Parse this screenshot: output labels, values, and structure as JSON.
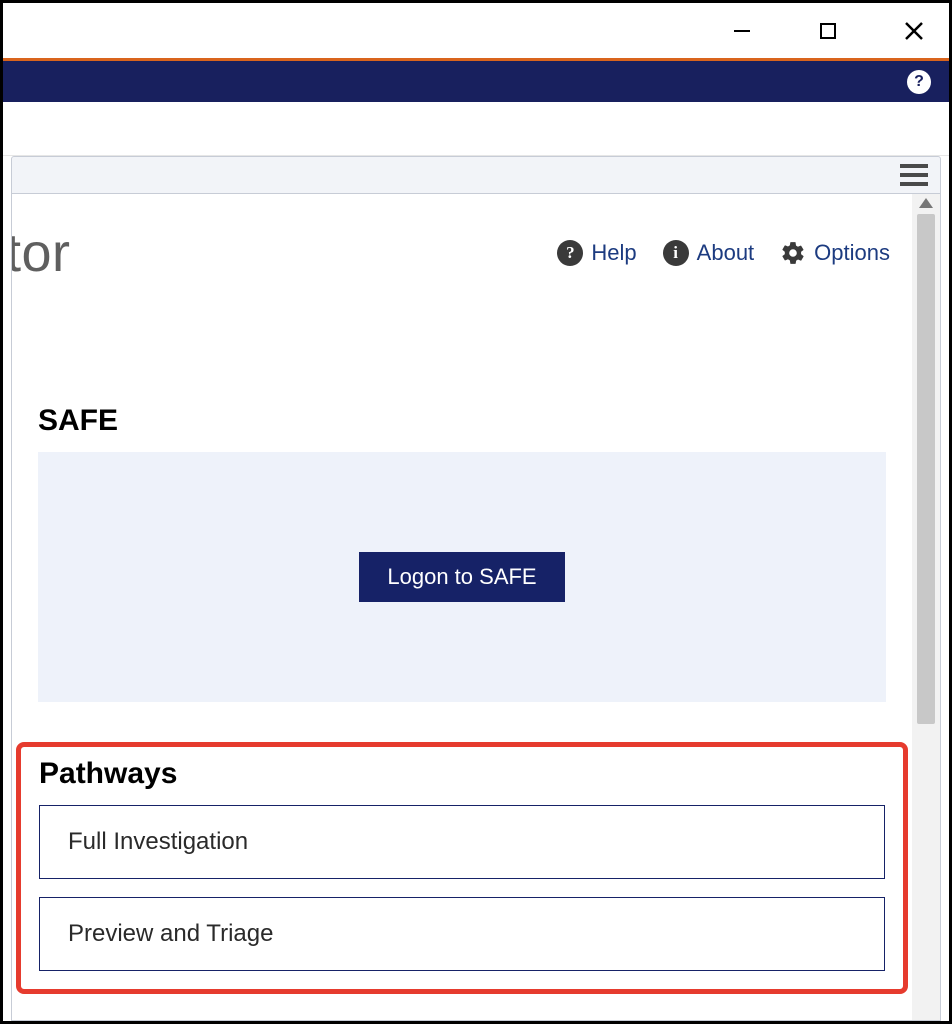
{
  "titlebar": {},
  "header": {},
  "page": {
    "title_fragment": "tor",
    "actions": {
      "help_label": "Help",
      "about_label": "About",
      "options_label": "Options"
    }
  },
  "safe": {
    "heading": "SAFE",
    "logon_button": "Logon to SAFE"
  },
  "pathways": {
    "heading": "Pathways",
    "items": [
      {
        "label": "Full Investigation"
      },
      {
        "label": "Preview and Triage"
      }
    ]
  }
}
